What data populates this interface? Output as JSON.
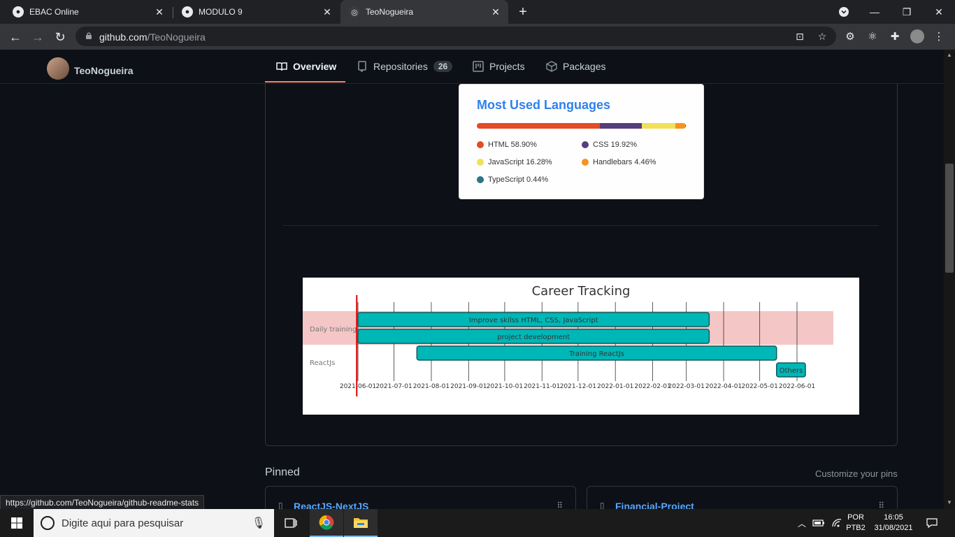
{
  "browser": {
    "tabs": [
      {
        "title": "EBAC Online",
        "active": false
      },
      {
        "title": "MODULO 9",
        "active": false
      },
      {
        "title": "TeoNogueira",
        "active": true
      }
    ],
    "new_tab": "+",
    "url_host": "github.com",
    "url_path": "/TeoNogueira",
    "window_controls": {
      "minimize": "—",
      "maximize": "❐",
      "close": "✕"
    }
  },
  "github": {
    "username": "TeoNogueira",
    "tabs": [
      {
        "label": "Overview",
        "icon": "book-icon",
        "selected": true
      },
      {
        "label": "Repositories",
        "icon": "repo-icon",
        "count": "26"
      },
      {
        "label": "Projects",
        "icon": "project-icon"
      },
      {
        "label": "Packages",
        "icon": "package-icon"
      }
    ]
  },
  "languages_card": {
    "title": "Most Used Languages",
    "items": [
      {
        "label": "HTML 58.90%",
        "color": "#e34c26",
        "pct": 58.9
      },
      {
        "label": "CSS 19.92%",
        "color": "#563d7c",
        "pct": 19.92
      },
      {
        "label": "JavaScript 16.28%",
        "color": "#f1e05a",
        "pct": 16.28
      },
      {
        "label": "Handlebars 4.46%",
        "color": "#f7931e",
        "pct": 4.46
      },
      {
        "label": "TypeScript 0.44%",
        "color": "#2b7489",
        "pct": 0.44
      }
    ]
  },
  "chart_data": {
    "type": "gantt",
    "title": "Career Tracking",
    "sections": [
      {
        "name": "Daily training",
        "shaded": true,
        "tasks": [
          {
            "label": "Improve skilss HTML, CSS, JavaScript",
            "start": "2021-06-01",
            "end": "2022-03-20"
          },
          {
            "label": "project development",
            "start": "2021-06-01",
            "end": "2022-03-20"
          }
        ]
      },
      {
        "name": "ReactJs",
        "shaded": false,
        "tasks": [
          {
            "label": "Training ReactJs",
            "start": "2021-07-20",
            "end": "2022-05-15"
          },
          {
            "label": "Others",
            "start": "2022-05-15",
            "end": "2022-06-08"
          }
        ]
      }
    ],
    "x_ticks": [
      "2021-06-01",
      "2021-07-01",
      "2021-08-01",
      "2021-09-01",
      "2021-10-01",
      "2021-11-01",
      "2021-12-01",
      "2022-01-01",
      "2022-02-01",
      "2022-03-01",
      "2022-04-01",
      "2022-05-01",
      "2022-06-01"
    ],
    "today_marker": "2021-05-31",
    "colors": {
      "bar": "#00b7b7",
      "bar_border": "#0c5d5d",
      "section_shade": "#f5c6c6",
      "today": "#e00000"
    }
  },
  "pinned": {
    "title": "Pinned",
    "customize": "Customize your pins",
    "repos": [
      {
        "name": "ReactJS-NextJS"
      },
      {
        "name": "Financial-Project"
      }
    ]
  },
  "status_url": "https://github.com/TeoNogueira/github-readme-stats",
  "taskbar": {
    "search_placeholder": "Digite aqui para pesquisar",
    "lang_top": "POR",
    "lang_bottom": "PTB2",
    "time": "16:05",
    "date": "31/08/2021"
  }
}
